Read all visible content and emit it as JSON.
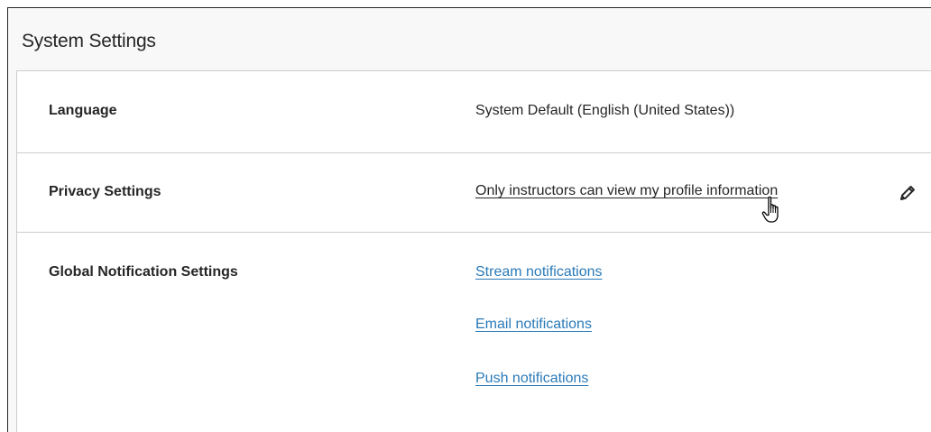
{
  "panel": {
    "title": "System Settings"
  },
  "rows": {
    "language": {
      "label": "Language",
      "value": "System Default (English (United States))"
    },
    "privacy": {
      "label": "Privacy Settings",
      "value": "Only instructors can view my profile information",
      "edit_icon": "pencil-icon"
    },
    "notifications": {
      "label": "Global Notification Settings",
      "links": [
        "Stream notifications",
        "Email notifications",
        "Push notifications"
      ]
    }
  },
  "colors": {
    "text": "#262626",
    "link": "#2a7ab8",
    "divider": "#cdcdcd",
    "header_bg": "#f8f8f8"
  }
}
